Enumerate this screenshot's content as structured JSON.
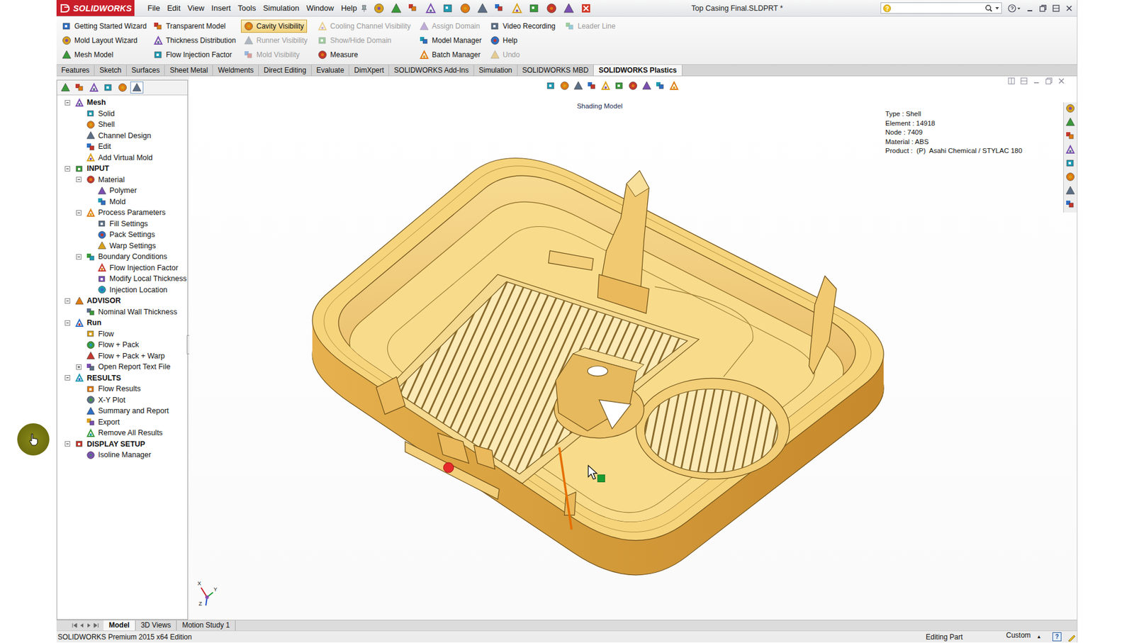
{
  "window": {
    "logo": "SOLIDWORKS",
    "title": "Top Casing Final.SLDPRT *"
  },
  "menu": [
    "File",
    "Edit",
    "View",
    "Insert",
    "Tools",
    "Simulation",
    "Window",
    "Help"
  ],
  "command_manager": [
    [
      {
        "label": "Getting Started Wizard",
        "disabled": false,
        "selected": false
      },
      {
        "label": "Mold Layout Wizard",
        "disabled": false,
        "selected": false
      },
      {
        "label": "Mesh Model",
        "disabled": false,
        "selected": false
      }
    ],
    [
      {
        "label": "Transparent Model",
        "disabled": false,
        "selected": false
      },
      {
        "label": "Thickness Distribution",
        "disabled": false,
        "selected": false
      },
      {
        "label": "Flow Injection Factor",
        "disabled": false,
        "selected": false
      }
    ],
    [
      {
        "label": "Cavity Visibility",
        "disabled": false,
        "selected": true
      },
      {
        "label": "Runner Visibility",
        "disabled": true,
        "selected": false
      },
      {
        "label": "Mold Visibility",
        "disabled": true,
        "selected": false
      }
    ],
    [
      {
        "label": "Cooling Channel Visibility",
        "disabled": true,
        "selected": false
      },
      {
        "label": "Show/Hide Domain",
        "disabled": true,
        "selected": false
      },
      {
        "label": "Measure",
        "disabled": false,
        "selected": false
      }
    ],
    [
      {
        "label": "Assign Domain",
        "disabled": true,
        "selected": false
      },
      {
        "label": "Model Manager",
        "disabled": false,
        "selected": false
      },
      {
        "label": "Batch Manager",
        "disabled": false,
        "selected": false
      }
    ],
    [
      {
        "label": "Video Recording",
        "disabled": false,
        "selected": false
      },
      {
        "label": "Help",
        "disabled": false,
        "selected": false
      },
      {
        "label": "Undo",
        "disabled": true,
        "selected": false
      }
    ],
    [
      {
        "label": "Leader Line",
        "disabled": true,
        "selected": false
      }
    ]
  ],
  "tabs": [
    {
      "label": "Features",
      "selected": false
    },
    {
      "label": "Sketch",
      "selected": false
    },
    {
      "label": "Surfaces",
      "selected": false
    },
    {
      "label": "Sheet Metal",
      "selected": false
    },
    {
      "label": "Weldments",
      "selected": false
    },
    {
      "label": "Direct Editing",
      "selected": false
    },
    {
      "label": "Evaluate",
      "selected": false
    },
    {
      "label": "DimXpert",
      "selected": false
    },
    {
      "label": "SOLIDWORKS Add-Ins",
      "selected": false
    },
    {
      "label": "Simulation",
      "selected": false
    },
    {
      "label": "SOLIDWORKS MBD",
      "selected": false
    },
    {
      "label": "SOLIDWORKS Plastics",
      "selected": true
    }
  ],
  "panel_tabs": [
    {
      "selected": false
    },
    {
      "selected": false
    },
    {
      "selected": false
    },
    {
      "selected": false
    },
    {
      "selected": false
    },
    {
      "selected": true
    }
  ],
  "tree": [
    {
      "label": "Mesh",
      "level": 0,
      "kind": "section",
      "expanded": true
    },
    {
      "label": "Solid",
      "level": 1,
      "kind": "item"
    },
    {
      "label": "Shell",
      "level": 1,
      "kind": "item"
    },
    {
      "label": "Channel Design",
      "level": 1,
      "kind": "item"
    },
    {
      "label": "Edit",
      "level": 1,
      "kind": "item"
    },
    {
      "label": "Add Virtual Mold",
      "level": 1,
      "kind": "item"
    },
    {
      "label": "INPUT",
      "level": 0,
      "kind": "section",
      "expanded": true
    },
    {
      "label": "Material",
      "level": 1,
      "kind": "group",
      "expanded": true
    },
    {
      "label": "Polymer",
      "level": 2,
      "kind": "item"
    },
    {
      "label": "Mold",
      "level": 2,
      "kind": "item"
    },
    {
      "label": "Process Parameters",
      "level": 1,
      "kind": "group",
      "expanded": true
    },
    {
      "label": "Fill Settings",
      "level": 2,
      "kind": "item"
    },
    {
      "label": "Pack Settings",
      "level": 2,
      "kind": "item"
    },
    {
      "label": "Warp Settings",
      "level": 2,
      "kind": "item"
    },
    {
      "label": "Boundary Conditions",
      "level": 1,
      "kind": "group",
      "expanded": true
    },
    {
      "label": "Flow Injection Factor",
      "level": 2,
      "kind": "item"
    },
    {
      "label": "Modify Local Thickness",
      "level": 2,
      "kind": "item"
    },
    {
      "label": "Injection Location",
      "level": 2,
      "kind": "item"
    },
    {
      "label": "ADVISOR",
      "level": 0,
      "kind": "section",
      "expanded": true
    },
    {
      "label": "Nominal Wall Thickness",
      "level": 1,
      "kind": "item"
    },
    {
      "label": "Run",
      "level": 0,
      "kind": "section",
      "expanded": true
    },
    {
      "label": "Flow",
      "level": 1,
      "kind": "item"
    },
    {
      "label": "Flow + Pack",
      "level": 1,
      "kind": "item"
    },
    {
      "label": "Flow + Pack + Warp",
      "level": 1,
      "kind": "item"
    },
    {
      "label": "Open Report Text File",
      "level": 1,
      "kind": "group",
      "expanded": false
    },
    {
      "label": "RESULTS",
      "level": 0,
      "kind": "section",
      "expanded": true
    },
    {
      "label": "Flow Results",
      "level": 1,
      "kind": "item"
    },
    {
      "label": "X-Y Plot",
      "level": 1,
      "kind": "item"
    },
    {
      "label": "Summary and Report",
      "level": 1,
      "kind": "item"
    },
    {
      "label": "Export",
      "level": 1,
      "kind": "item"
    },
    {
      "label": "Remove All Results",
      "level": 1,
      "kind": "item"
    },
    {
      "label": "DISPLAY SETUP",
      "level": 0,
      "kind": "section",
      "expanded": true
    },
    {
      "label": "Isoline Manager",
      "level": 1,
      "kind": "item"
    }
  ],
  "graphics": {
    "heading": "Shading Model",
    "info": [
      "Type : Shell",
      "Element : 14918",
      "Node : 7409",
      "Material : ABS",
      "Product :  (P)  Asahi Chemical / STYLAC 180"
    ],
    "triad": [
      "X",
      "Y",
      "Z"
    ]
  },
  "bottom_tabs": [
    {
      "label": "Model",
      "selected": true
    },
    {
      "label": "3D Views",
      "selected": false
    },
    {
      "label": "Motion Study 1",
      "selected": false
    }
  ],
  "status_bar": {
    "edition": "SOLIDWORKS Premium 2015 x64 Edition",
    "mode": "Editing Part",
    "units": "Custom",
    "units_arrow": "▲",
    "help": "?"
  }
}
